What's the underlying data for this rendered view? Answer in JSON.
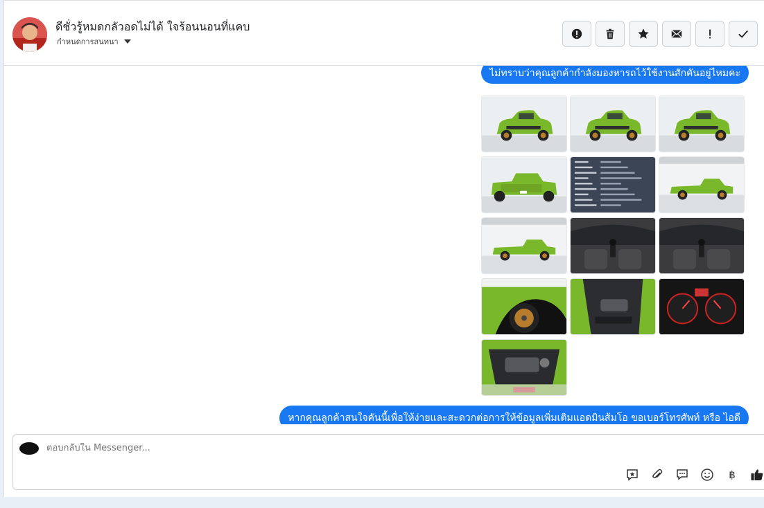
{
  "header": {
    "contact_name": "ดีชั่วรู้หมดกลัวอดไม่ได้ ใจร้อนนอนที่แคบ",
    "conversation_setting": "กำหนดการสนทนา",
    "actions": [
      {
        "name": "spam-button",
        "icon": "exclamation-circle-icon"
      },
      {
        "name": "delete-button",
        "icon": "trash-icon"
      },
      {
        "name": "star-button",
        "icon": "star-icon"
      },
      {
        "name": "mark-unread-button",
        "icon": "envelope-icon"
      },
      {
        "name": "follow-up-button",
        "icon": "exclamation-icon"
      },
      {
        "name": "mark-done-button",
        "icon": "check-icon"
      }
    ]
  },
  "thread": {
    "message_top": "ไม่ทราบว่าคุณลูกค้ากำลังมองหารถไว้ใช้งานสักคันอยู่ไหมคะ",
    "message_bottom": "หากคุณลูกค้าสนใจคันนี้เพื่อให้ง่ายและสะดวกต่อการให้ข้อมูลเพิ่มเติมแอดมินส้มโอ ขอเบอร์โทรศัพท์ หรือ ไอดี",
    "photos": [
      {
        "name": "photo-front-left",
        "kind": "car"
      },
      {
        "name": "photo-front",
        "kind": "car"
      },
      {
        "name": "photo-front-right",
        "kind": "car"
      },
      {
        "name": "photo-rear",
        "kind": "car-rear"
      },
      {
        "name": "photo-spec-sheet",
        "kind": "spec"
      },
      {
        "name": "photo-side",
        "kind": "car-side"
      },
      {
        "name": "photo-side-far",
        "kind": "car-side"
      },
      {
        "name": "photo-gear-shift",
        "kind": "interior"
      },
      {
        "name": "photo-dashboard",
        "kind": "interior"
      },
      {
        "name": "photo-wheel",
        "kind": "wheel"
      },
      {
        "name": "photo-door-panel",
        "kind": "door"
      },
      {
        "name": "photo-gauges",
        "kind": "gauge"
      },
      {
        "name": "photo-engine",
        "kind": "engine"
      }
    ]
  },
  "composer": {
    "placeholder": "ตอบกลับใน Messenger...",
    "tools": [
      "saved-reply-icon",
      "paperclip-icon",
      "chat-icon",
      "emoji-icon",
      "baht-icon",
      "thumbs-up-icon"
    ],
    "baht_symbol": "฿"
  },
  "colors": {
    "accent": "#1778f2",
    "car_green": "#7ab82b",
    "background": "#e9eff7"
  }
}
